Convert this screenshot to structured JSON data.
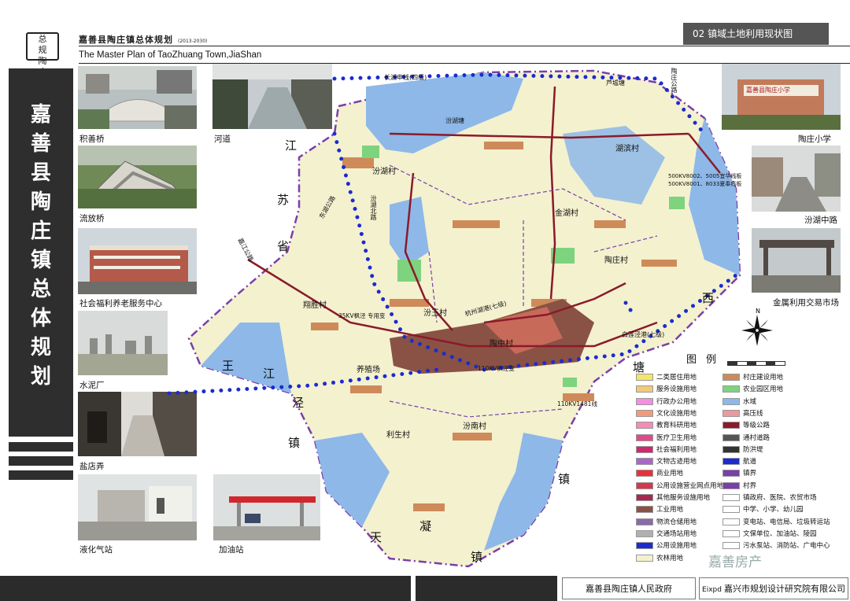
{
  "header": {
    "logo_text": "总规 陶庄",
    "title_cn": "嘉善县陶庄镇总体规划",
    "title_years": "(2013-2030)",
    "title_en": "The Master Plan of TaoZhuang Town,JiaShan",
    "section": "02  镇域土地利用现状图"
  },
  "sidebar": {
    "title": "嘉善县陶庄镇总体规划"
  },
  "photos": [
    {
      "caption": "积善桥"
    },
    {
      "caption": "河道"
    },
    {
      "caption": "流放桥"
    },
    {
      "caption": "社会福利养老服务中心"
    },
    {
      "caption": "水泥厂"
    },
    {
      "caption": "盐店弄"
    },
    {
      "caption": "液化气站"
    },
    {
      "caption": "加油站"
    },
    {
      "caption": "陶庄小学"
    },
    {
      "caption": "汾湖中路"
    },
    {
      "caption": "金属利用交易市场"
    }
  ],
  "photo_signs": {
    "school_sign": "嘉善县陶庄小学"
  },
  "map": {
    "regions": {
      "jiangsu": "江苏省",
      "west": "西",
      "wangjiangjing": "王江泾镇",
      "tianning": "天凝镇",
      "tang": "塘"
    },
    "villages": [
      "汾湖村",
      "金湖村",
      "陶庄村",
      "翔胜村",
      "汾玉村",
      "陶中村",
      "利生村",
      "汾南村",
      "湖滨村",
      "养殖场"
    ],
    "roads": [
      "长湖申线(四级)",
      "芦墟塘",
      "汾湖塘",
      "汾湖北路",
      "陶庄公路",
      "嘉江公路",
      "东湖公路",
      "白莲泾港(七级)",
      "杭州湖港(七级)"
    ],
    "lines": [
      "35KV枫泾 专用变",
      "500KV8002、5005宜华线板",
      "500KV8001、8033夏奉线板",
      "110KV枫泾变",
      "110KV1481线"
    ],
    "facility_labels": [
      "陶庄公路"
    ],
    "colors": {
      "water": "#8db8e8",
      "farmland": "#f4f1cf",
      "village": "#cf8a5a",
      "industry": "#8a5244",
      "green": "#7ed37e",
      "town": "#a85a4e",
      "boundary": "#7a3fa8",
      "channel": "#1c2bd0",
      "road": "#8b1a2a"
    }
  },
  "legend": {
    "title": "图例",
    "items_left": [
      {
        "label": "二类居住用地",
        "color": "#f5e46a"
      },
      {
        "label": "服务设施用地",
        "color": "#f2c97a"
      },
      {
        "label": "行政办公用地",
        "color": "#f28fe0"
      },
      {
        "label": "文化设施用地",
        "color": "#f49a7c"
      },
      {
        "label": "教育科研用地",
        "color": "#f28db8"
      },
      {
        "label": "医疗卫生用地",
        "color": "#e04a8a"
      },
      {
        "label": "社会福利用地",
        "color": "#cc2a6a"
      },
      {
        "label": "文物古迹用地",
        "color": "#a868c8"
      },
      {
        "label": "商业用地",
        "color": "#e8323a"
      },
      {
        "label": "公用设施营业网点用地",
        "color": "#d4384a"
      },
      {
        "label": "其他服务设施用地",
        "color": "#a82852"
      },
      {
        "label": "工业用地",
        "color": "#8a5244"
      },
      {
        "label": "物流仓储用地",
        "color": "#8a6aa8"
      },
      {
        "label": "交通场站用地",
        "color": "#b0b0b0"
      },
      {
        "label": "公用设施用地",
        "color": "#1c2bd0"
      },
      {
        "label": "农林用地",
        "color": "#f4f1cf"
      }
    ],
    "items_right": [
      {
        "label": "村庄建设用地",
        "color": "#cf8a5a"
      },
      {
        "label": "农业园区用地",
        "color": "#7ed37e"
      },
      {
        "label": "水域",
        "color": "#8db8e8"
      },
      {
        "label": "高压线",
        "color": "#e89aa0"
      },
      {
        "label": "等级公路",
        "color": "#8b1a2a"
      },
      {
        "label": "通村道路",
        "color": "#555555"
      },
      {
        "label": "防洪堤",
        "color": "#333333"
      },
      {
        "label": "航道",
        "color": "#1c2bd0"
      },
      {
        "label": "镇界",
        "color": "#7a3fa8"
      },
      {
        "label": "村界",
        "color": "#7a3fa8"
      },
      {
        "label": "镇政府、医院、农贸市场",
        "color": "#ffffff"
      },
      {
        "label": "中学、小学、幼儿园",
        "color": "#ffffff"
      },
      {
        "label": "变电站、电信局、垃圾转运站",
        "color": "#ffffff"
      },
      {
        "label": "文保单位、加油站、陵园",
        "color": "#ffffff"
      },
      {
        "label": "污水泵站、消防站、广电中心",
        "color": "#ffffff"
      }
    ]
  },
  "footer": {
    "government": "嘉善县陶庄镇人民政府",
    "institute": "嘉兴市规划设计研究院有限公司",
    "institute_logo": "Eixpd",
    "watermark": "嘉善房产"
  }
}
